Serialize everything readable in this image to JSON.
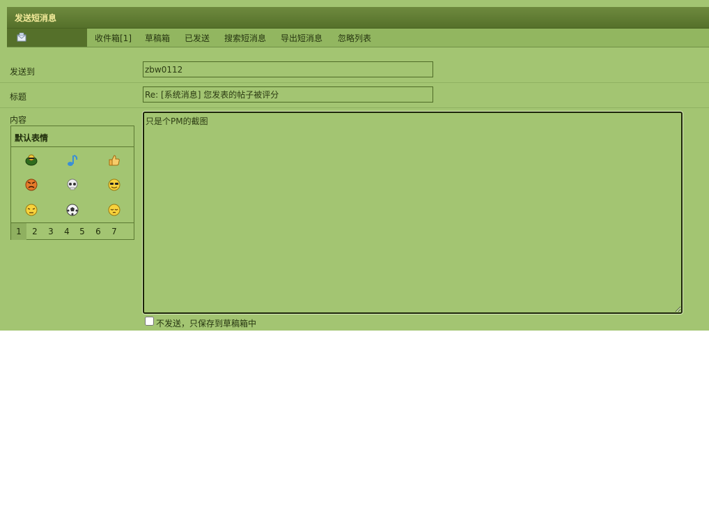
{
  "header": {
    "title": "发送短消息"
  },
  "nav": {
    "items": [
      {
        "label": "收件箱[1]",
        "name": "nav-inbox"
      },
      {
        "label": "草稿箱",
        "name": "nav-drafts"
      },
      {
        "label": "已发送",
        "name": "nav-sent"
      },
      {
        "label": "搜索短消息",
        "name": "nav-search"
      },
      {
        "label": "导出短消息",
        "name": "nav-export"
      },
      {
        "label": "忽略列表",
        "name": "nav-ignore"
      }
    ]
  },
  "form": {
    "to_label": "发送到",
    "to_value": "zbw0112",
    "subject_label": "标题",
    "subject_value": "Re: [系统消息] 您发表的帖子被评分",
    "content_label": "内容",
    "content_value": "只是个PM的截图",
    "save_only_label": "不发送，只保存到草稿箱中"
  },
  "emoji_panel": {
    "title": "默认表情",
    "icons": [
      "turtle-icon",
      "music-note-icon",
      "thumbs-up-icon",
      "angry-icon",
      "skull-icon",
      "sunglasses-icon",
      "sweat-icon",
      "soccer-ball-icon",
      "sleepy-icon"
    ],
    "pages": [
      "1",
      "2",
      "3",
      "4",
      "5",
      "6",
      "7"
    ],
    "active_page": "1"
  },
  "colors": {
    "panel_bg": "#a3c572",
    "title_bar": "#55702a",
    "title_text": "#f3ea9a",
    "nav_bg": "#92b660"
  }
}
